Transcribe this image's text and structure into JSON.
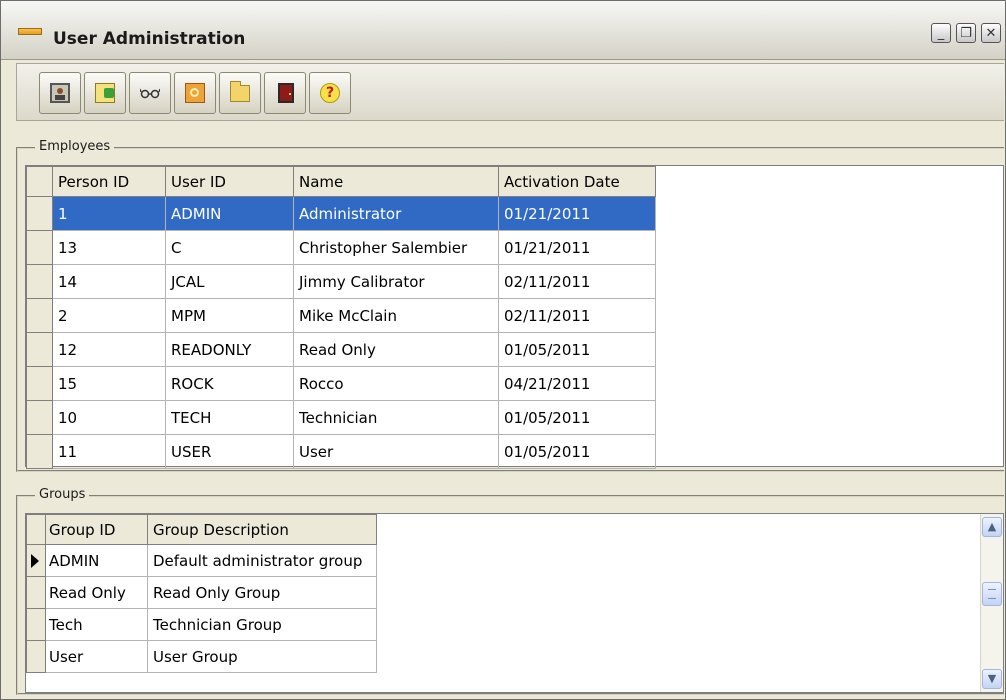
{
  "window": {
    "title": "User Administration"
  },
  "title_buttons": {
    "minimize": "_",
    "restore": "❐",
    "close": "✕"
  },
  "toolbar": {
    "buttons": [
      {
        "icon": "user-card-icon"
      },
      {
        "icon": "add-user-icon"
      },
      {
        "icon": "glasses-icon"
      },
      {
        "icon": "key-icon"
      },
      {
        "icon": "folder-icon"
      },
      {
        "icon": "exit-door-icon"
      },
      {
        "icon": "help-icon",
        "glyph": "?"
      }
    ]
  },
  "employees": {
    "legend": "Employees",
    "columns": [
      "Person ID",
      "User ID",
      "Name",
      "Activation Date"
    ],
    "rows": [
      [
        "1",
        "ADMIN",
        "Administrator",
        "01/21/2011"
      ],
      [
        "13",
        "C",
        "Christopher Salembier",
        "01/21/2011"
      ],
      [
        "14",
        "JCAL",
        "Jimmy Calibrator",
        "02/11/2011"
      ],
      [
        "2",
        "MPM",
        "Mike McClain",
        "02/11/2011"
      ],
      [
        "12",
        "READONLY",
        "Read Only",
        "01/05/2011"
      ],
      [
        "15",
        "ROCK",
        "Rocco",
        "04/21/2011"
      ],
      [
        "10",
        "TECH",
        "Technician",
        "01/05/2011"
      ],
      [
        "11",
        "USER",
        "User",
        "01/05/2011"
      ]
    ],
    "selected_row": 0
  },
  "groups": {
    "legend": "Groups",
    "columns": [
      "Group ID",
      "Group Description"
    ],
    "rows": [
      [
        "ADMIN",
        "Default administrator group"
      ],
      [
        "Read Only",
        "Read Only Group"
      ],
      [
        "Tech",
        "Technician Group"
      ],
      [
        "User",
        "User Group"
      ]
    ],
    "current_row": 0
  },
  "scrollbar": {
    "up": "▲",
    "down": "▼"
  },
  "colors": {
    "selection": "#316ac5",
    "frame": "#ece9d8"
  }
}
